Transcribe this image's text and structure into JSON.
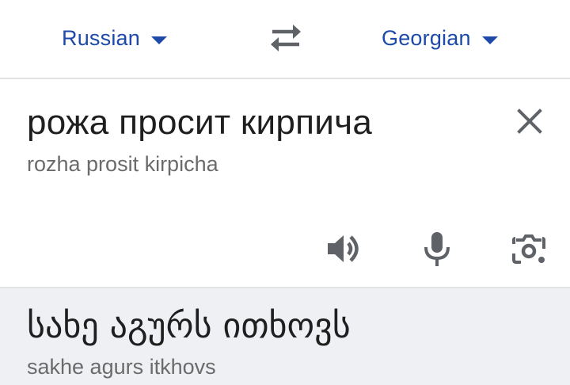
{
  "language_bar": {
    "source_language": "Russian",
    "target_language": "Georgian",
    "swap_icon": "swap-arrows-icon",
    "caret_icon": "caret-down-icon"
  },
  "input": {
    "text": "рожа просит кирпича",
    "transliteration": "rozha prosit kirpicha",
    "clear_icon": "close-icon",
    "tools": {
      "listen_icon": "speaker-icon",
      "voice_icon": "microphone-icon",
      "camera_icon": "camera-lens-icon"
    }
  },
  "result": {
    "text": "სახე აგურს ითხოვს",
    "transliteration": "sakhe agurs itkhovs"
  },
  "colors": {
    "accent": "#1d4aa8",
    "icon": "#5f6368",
    "divider": "#e3e3e3",
    "result_background": "#eef0f3"
  }
}
